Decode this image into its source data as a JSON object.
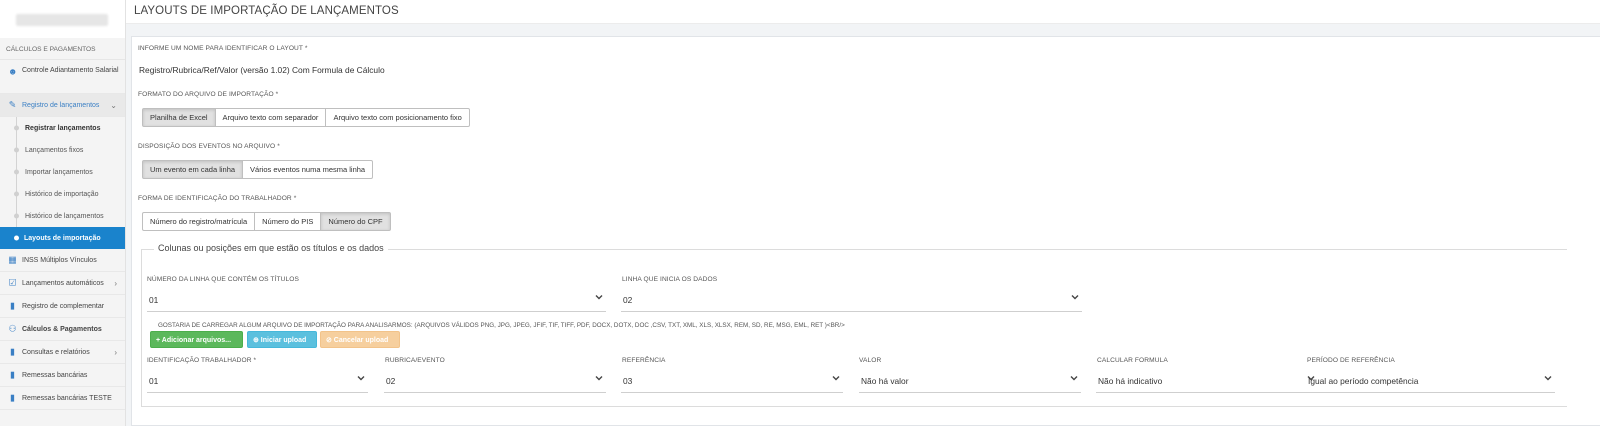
{
  "sidebar": {
    "section_title": "CÁLCULOS E PAGAMENTOS",
    "items_top": [
      {
        "label": "Controle Adiantamento Salarial",
        "icon": "person-money-icon"
      },
      {
        "label": "Registro de lançamentos",
        "icon": "edit-icon"
      }
    ],
    "sub_items": [
      {
        "label": "Registrar lançamentos"
      },
      {
        "label": "Lançamentos fixos"
      },
      {
        "label": "Importar lançamentos"
      },
      {
        "label": "Histórico de importação"
      },
      {
        "label": "Histórico de lançamentos"
      },
      {
        "label": "Layouts de importação"
      }
    ],
    "items_bottom": [
      {
        "label": "INSS Múltiplos Vínculos",
        "icon": "building-icon"
      },
      {
        "label": "Lançamentos automáticos",
        "icon": "checkbox-icon"
      },
      {
        "label": "Registro de complementar",
        "icon": "document-icon"
      },
      {
        "label": "Cálculos & Pagamentos",
        "icon": "people-icon"
      },
      {
        "label": "Consultas e relatórios",
        "icon": "report-icon"
      },
      {
        "label": "Remessas bancárias",
        "icon": "document-icon"
      },
      {
        "label": "Remessas bancárias TESTE",
        "icon": "document-icon"
      }
    ]
  },
  "header": {
    "title": "LAYOUTS DE IMPORTAÇÃO DE LANÇAMENTOS"
  },
  "form": {
    "name_label": "INFORME UM NOME PARA IDENTIFICAR O LAYOUT *",
    "name_value": "Registro/Rubrica/Ref/Valor (versão 1.02) Com Formula de Cálculo",
    "format_label": "FORMATO DO ARQUIVO DE IMPORTAÇÃO *",
    "format_options": [
      "Planilha de Excel",
      "Arquivo texto com separador",
      "Arquivo texto com posicionamento fixo"
    ],
    "format_selected": 0,
    "disposition_label": "DISPOSIÇÃO DOS EVENTOS NO ARQUIVO *",
    "disposition_options": [
      "Um evento em cada linha",
      "Vários eventos numa mesma linha"
    ],
    "disposition_selected": 0,
    "worker_id_label": "FORMA DE IDENTIFICAÇÃO DO TRABALHADOR *",
    "worker_id_options": [
      "Número do registro/matrícula",
      "Número do PIS",
      "Número do CPF"
    ],
    "worker_id_selected": 2,
    "columns_legend": "Colunas ou posições em que estão os títulos e os dados",
    "title_row_label": "NÚMERO DA LINHA QUE CONTÉM OS TÍTULOS",
    "title_row_value": "01",
    "data_row_label": "LINHA QUE INICIA OS DADOS",
    "data_row_value": "02",
    "upload_note": "GOSTARIA DE CARREGAR ALGUM ARQUIVO DE IMPORTAÇÃO PARA ANALISARMOS: (ARQUIVOS VÁLIDOS PNG, JPG, JPEG, JFIF, TIF, TIFF, PDF, DOCX, DOTX, DOC ,CSV, TXT, XML, XLS, XLSX, REM, SD, RE, MSG, EML, RET )<BR/>",
    "upload_buttons": {
      "add": "+ Adicionar arquivos...",
      "start": "⊕ Iniciar upload",
      "cancel": "⊘ Cancelar upload"
    },
    "mapping": [
      {
        "label": "IDENTIFICAÇÃO TRABALHADOR *",
        "value": "01"
      },
      {
        "label": "RUBRICA/EVENTO",
        "value": "02"
      },
      {
        "label": "REFERÊNCIA",
        "value": "03"
      },
      {
        "label": "VALOR",
        "value": "Não há valor"
      },
      {
        "label": "CALCULAR FORMULA",
        "value": "Não há indicativo"
      },
      {
        "label": "PERÍODO DE REFERÊNCIA",
        "value": "Igual ao período competência"
      }
    ]
  },
  "colors": {
    "active_blue": "#1a83cc",
    "green_button": "#5cb85c",
    "info_button": "#5bc0de",
    "warning_button_disabled": "#f6cf9e"
  }
}
